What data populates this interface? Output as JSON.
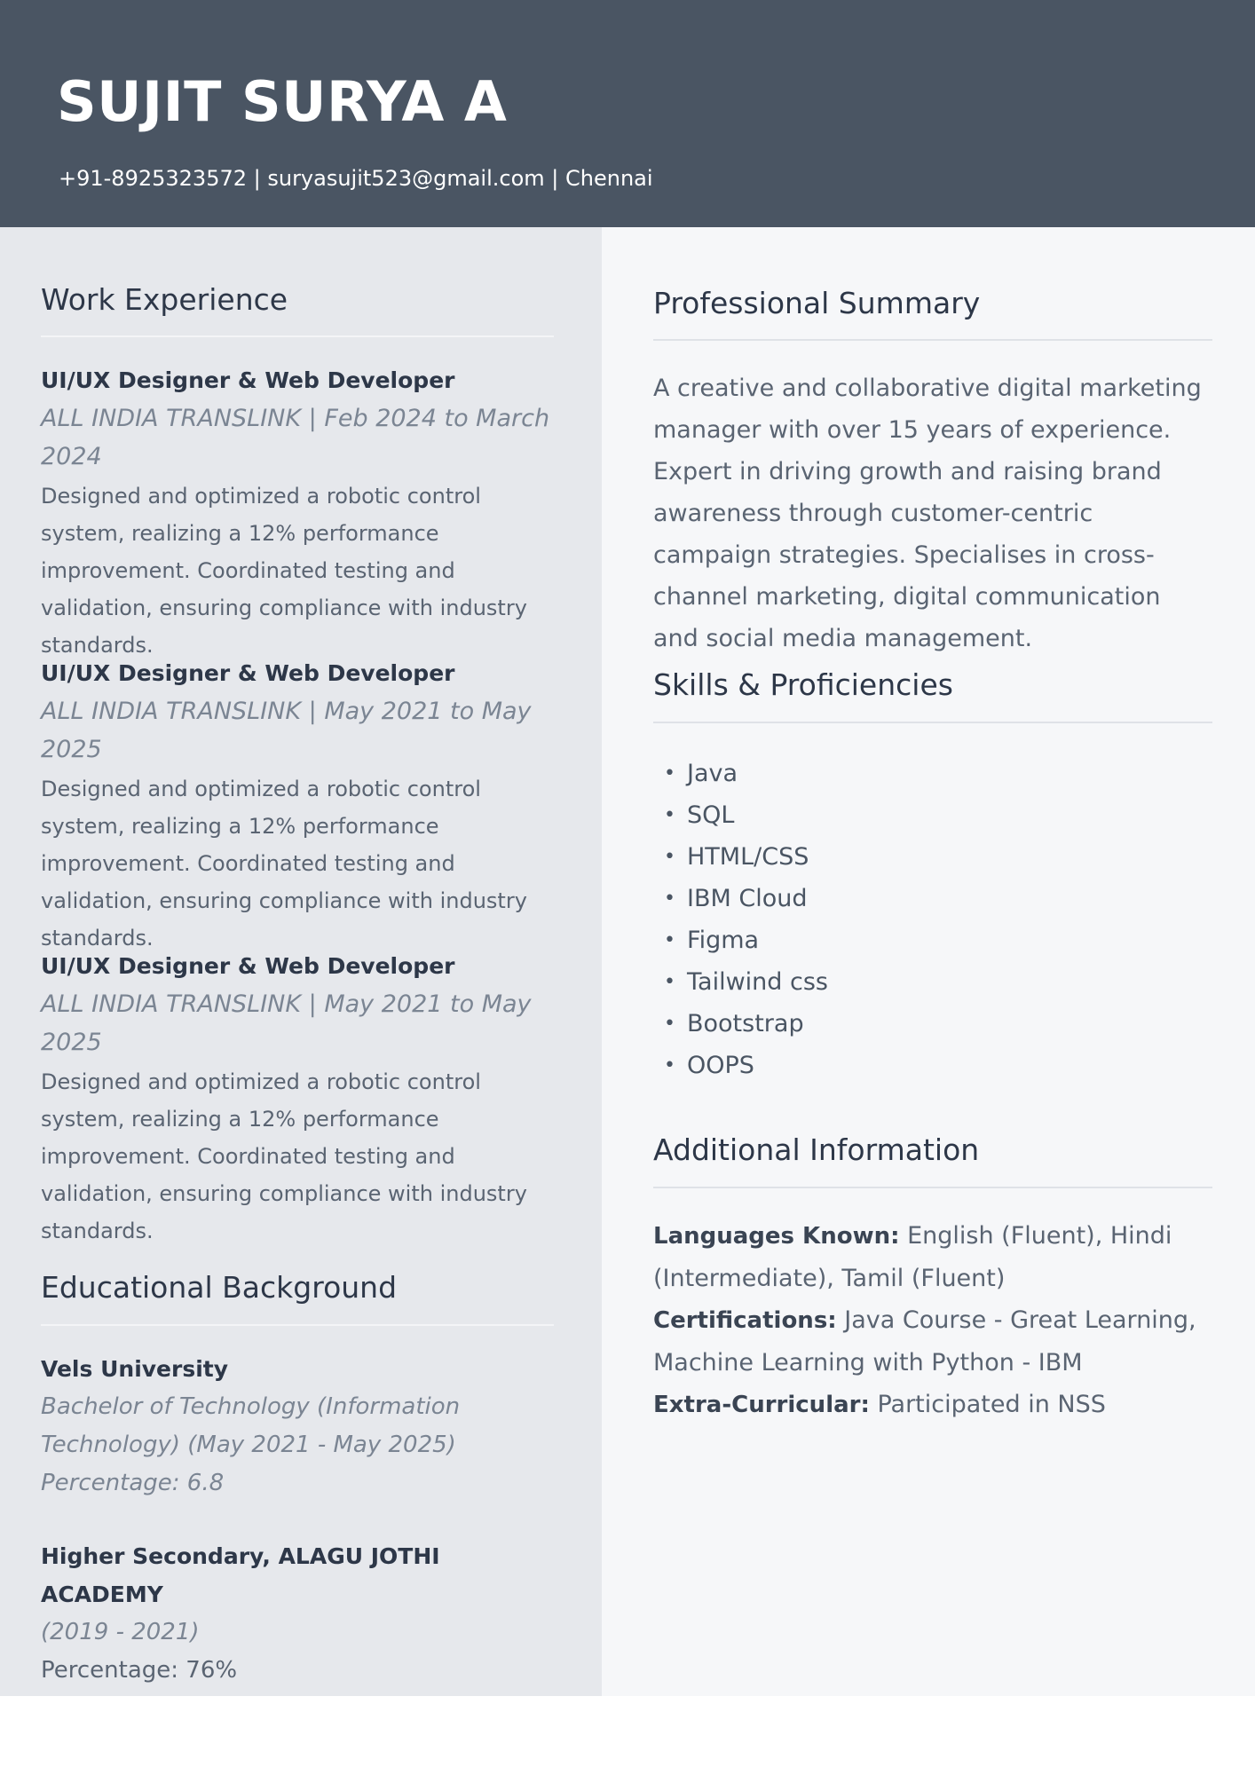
{
  "header": {
    "name": "SUJIT SURYA A",
    "contact": "+91-8925323572 | suryasujit523@gmail.com | Chennai"
  },
  "work_experience": {
    "title": "Work Experience",
    "jobs": [
      {
        "role": "UI/UX Designer & Web Developer",
        "meta": "ALL INDIA TRANSLINK | Feb 2024 to March 2024",
        "description": "Designed and optimized a robotic control system, realizing a 12% performance improvement. Coordinated testing and validation, ensuring compliance with industry standards."
      },
      {
        "role": "UI/UX Designer & Web Developer",
        "meta": "ALL INDIA TRANSLINK | May 2021 to May 2025",
        "description": "Designed and optimized a robotic control system, realizing a 12% performance improvement. Coordinated testing and validation, ensuring compliance with industry standards."
      },
      {
        "role": "UI/UX Designer & Web Developer",
        "meta": "ALL INDIA TRANSLINK | May 2021 to May 2025",
        "description": "Designed and optimized a robotic control system, realizing a 12% performance improvement. Coordinated testing and validation, ensuring compliance with industry standards."
      }
    ]
  },
  "education": {
    "title": "Educational Background",
    "entries": [
      {
        "name": "Vels University",
        "degree": "Bachelor of Technology (Information Technology) (May 2021 - May 2025)",
        "score": "Percentage: 6.8"
      },
      {
        "name": "Higher Secondary, ALAGU JOTHI ACADEMY",
        "period": "(2019 - 2021)",
        "score": "Percentage: 76%"
      }
    ]
  },
  "summary": {
    "title": "Professional Summary",
    "text": "A creative and collaborative digital marketing manager with over 15 years of experience. Expert in driving growth and raising brand awareness through customer-centric campaign strategies. Specialises in cross-channel marketing, digital communication and social media management."
  },
  "skills": {
    "title": "Skills & Proficiencies",
    "items": [
      "Java",
      "SQL",
      "HTML/CSS",
      "IBM Cloud",
      "Figma",
      "Tailwind css",
      "Bootstrap",
      "OOPS"
    ]
  },
  "additional": {
    "title": "Additional Information",
    "languages_label": "Languages Known:",
    "languages_value": "English (Fluent), Hindi (Intermediate), Tamil (Fluent)",
    "certifications_label": "Certifications:",
    "certifications_value": "Java Course - Great Learning, Machine Learning with Python - IBM",
    "extra_label": "Extra-Curricular:",
    "extra_value": "Participated in NSS"
  },
  "colors": {
    "header_bg": "#4a5563",
    "left_bg": "#e6e8ec",
    "right_bg": "#f6f7f9"
  }
}
